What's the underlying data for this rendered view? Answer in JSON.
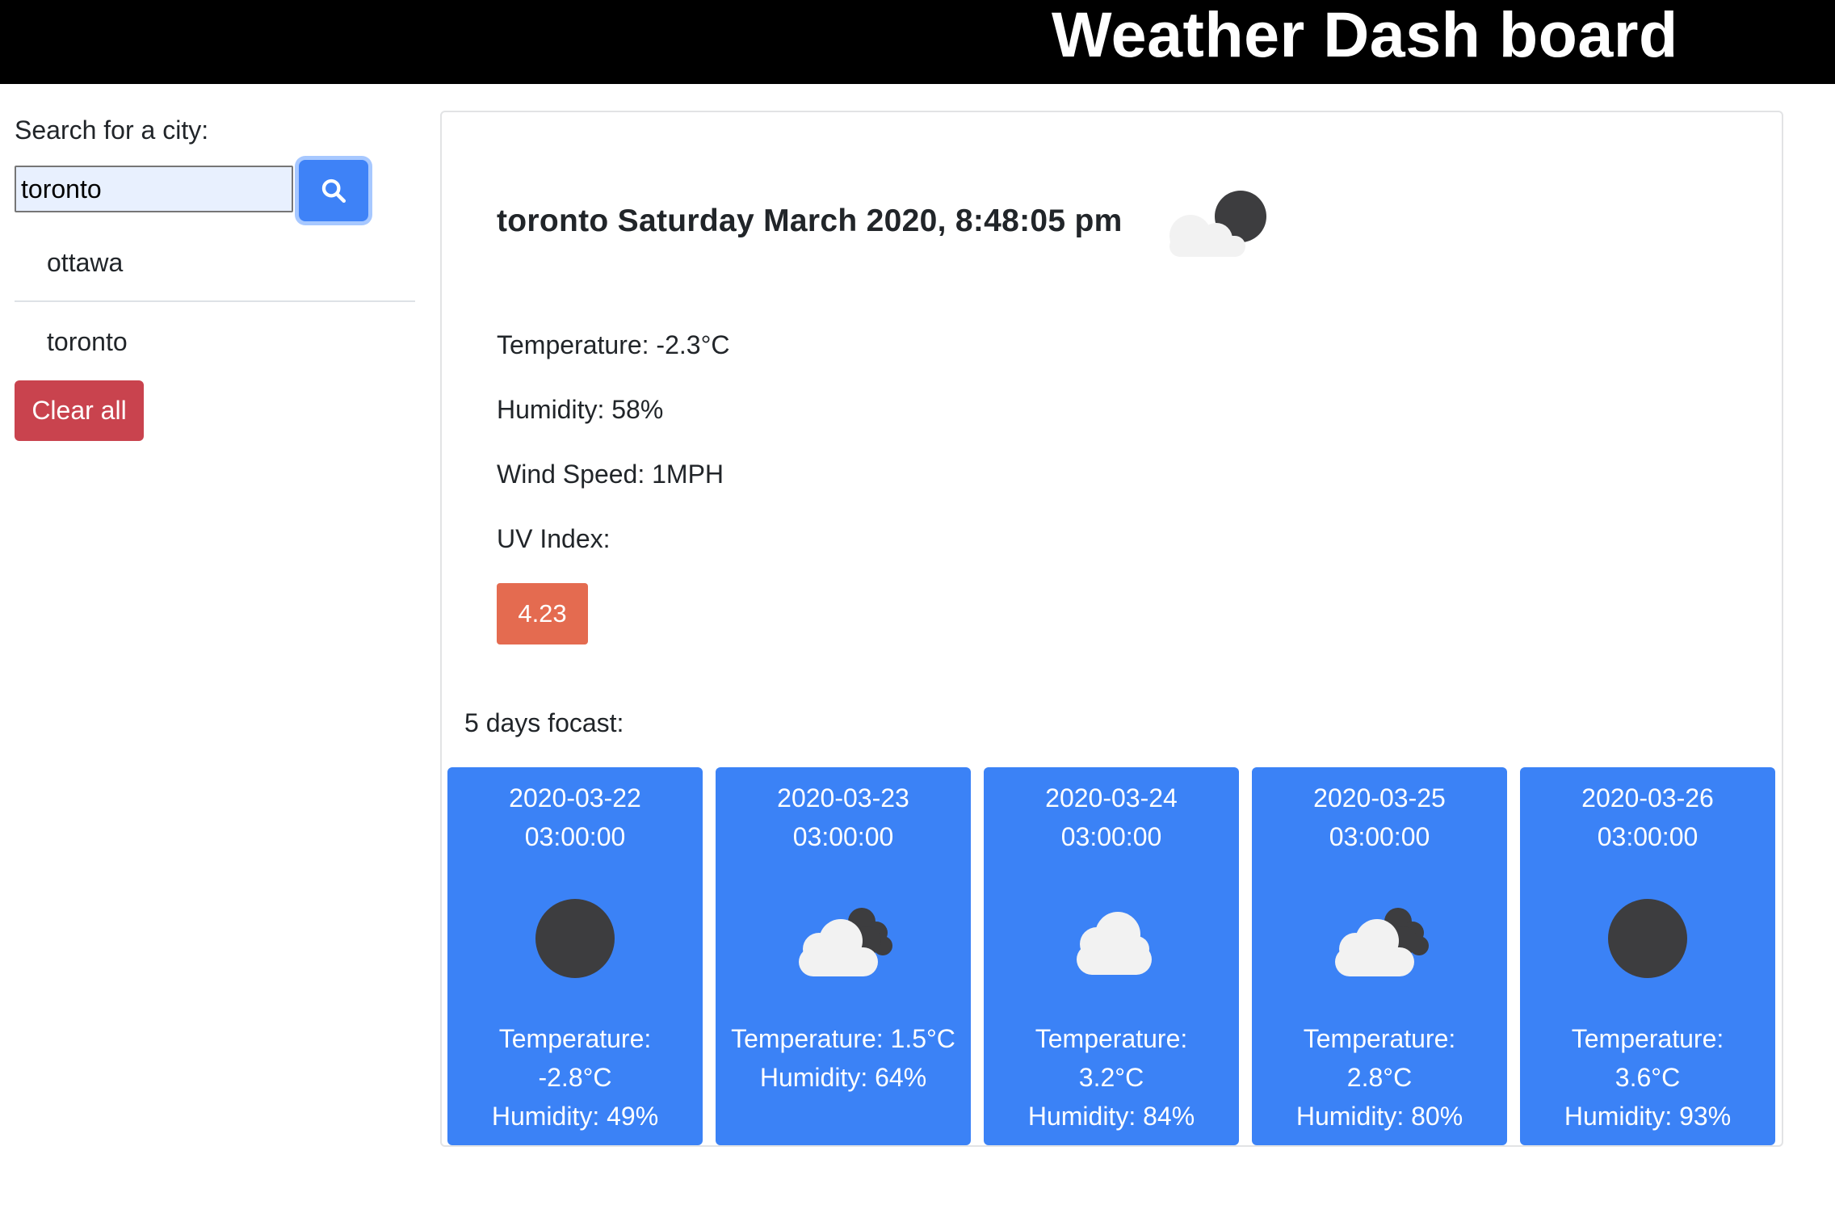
{
  "header": {
    "title": "Weather Dash board"
  },
  "sidebar": {
    "search_label": "Search for a city:",
    "search_value": "toronto",
    "search_icon": "search-icon",
    "history": [
      {
        "label": "ottawa"
      },
      {
        "label": "toronto"
      }
    ],
    "clear_label": "Clear all"
  },
  "current": {
    "title": "toronto Saturday March 2020, 8:48:05 pm",
    "icon": "partly-cloudy-night-icon",
    "temperature": "Temperature: -2.3°C",
    "humidity": "Humidity: 58%",
    "wind_speed": "Wind Speed: 1MPH",
    "uv_label": "UV Index:",
    "uv_value": "4.23"
  },
  "forecast": {
    "label": "5 days focast:",
    "days": [
      {
        "date": "2020-03-22",
        "time": "03:00:00",
        "icon": "clear-night-icon",
        "temperature_label": "Temperature:",
        "temperature_value": "-2.8°C",
        "humidity": "Humidity: 49%"
      },
      {
        "date": "2020-03-23",
        "time": "03:00:00",
        "icon": "cloudy-night-icon",
        "temperature_label": "Temperature:",
        "temperature_value": "1.5°C",
        "humidity": "Humidity: 64%"
      },
      {
        "date": "2020-03-24",
        "time": "03:00:00",
        "icon": "cloud-icon",
        "temperature_label": "Temperature:",
        "temperature_value": "3.2°C",
        "humidity": "Humidity: 84%"
      },
      {
        "date": "2020-03-25",
        "time": "03:00:00",
        "icon": "cloudy-night-icon",
        "temperature_label": "Temperature:",
        "temperature_value": "2.8°C",
        "humidity": "Humidity: 80%"
      },
      {
        "date": "2020-03-26",
        "time": "03:00:00",
        "icon": "clear-night-icon",
        "temperature_label": "Temperature:",
        "temperature_value": "3.6°C",
        "humidity": "Humidity: 93%"
      }
    ]
  },
  "colors": {
    "header_bg": "#000000",
    "primary": "#3b82f6",
    "danger": "#c9434e",
    "uv_badge": "#e46b50"
  }
}
